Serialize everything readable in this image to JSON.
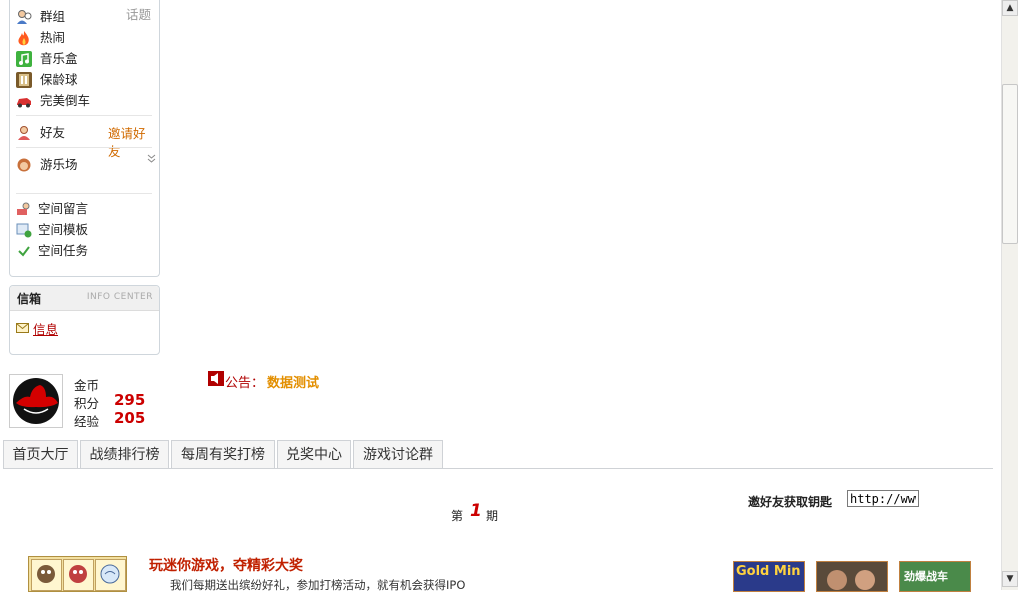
{
  "sidebar": {
    "items": [
      {
        "label": "群组",
        "side": "话题",
        "icon": "group-icon"
      },
      {
        "label": "热闹",
        "icon": "fire-icon"
      },
      {
        "label": "音乐盒",
        "icon": "music-box-icon"
      },
      {
        "label": "保龄球",
        "icon": "bowling-icon"
      },
      {
        "label": "完美倒车",
        "icon": "car-icon"
      }
    ],
    "friends": {
      "label": "好友",
      "invite": "邀请好友",
      "icon": "friend-icon"
    },
    "playground": {
      "label": "游乐场",
      "icon": "playground-icon",
      "chevron": "double-chevron-down-icon"
    },
    "space": [
      {
        "label": "空间留言",
        "icon": "space-message-icon"
      },
      {
        "label": "空间模板",
        "icon": "space-template-icon"
      },
      {
        "label": "空间任务",
        "icon": "space-task-icon"
      }
    ]
  },
  "mailbox": {
    "title": "信箱",
    "subtitle": "INFO CENTER",
    "link": "信息",
    "icon": "envelope-icon"
  },
  "user": {
    "stats": [
      {
        "label": "金币",
        "value": ""
      },
      {
        "label": "积分",
        "value": "295"
      },
      {
        "label": "经验",
        "value": "205"
      }
    ]
  },
  "announcement": {
    "prefix": "公告：",
    "text": "数据测试",
    "icon": "speaker-icon"
  },
  "tabs": [
    "首页大厅",
    "战绩排行榜",
    "每周有奖打榜",
    "兑奖中心",
    "游戏讨论群"
  ],
  "issue": {
    "pre": "第",
    "number": "1",
    "post": "期"
  },
  "invite_key": {
    "label": "邀好友获取钥匙",
    "value": "http://www"
  },
  "promo": {
    "title": "玩迷你游戏，夺精彩大奖",
    "desc": "我们每期送出缤纷好礼，参加打榜活动，就有机会获得IPO"
  },
  "games": [
    "Gold Min",
    "",
    "劲爆战车"
  ],
  "colors": {
    "accent_red": "#cc0000",
    "orange": "#e38f00",
    "invite": "#d06a00"
  }
}
